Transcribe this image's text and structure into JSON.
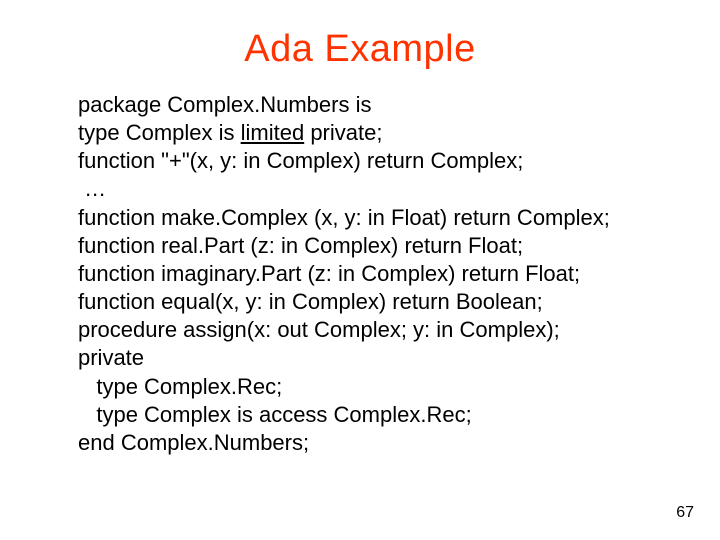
{
  "title": "Ada Example",
  "code": {
    "l1": "package Complex.Numbers is",
    "l2a": "type Complex is ",
    "l2b": "limited",
    "l2c": " private;",
    "l3": "function \"+\"(x, y: in Complex) return Complex;",
    "l4": " …",
    "l5": "function make.Complex (x, y: in Float) return Complex;",
    "l6": "function real.Part (z: in Complex) return Float;",
    "l7": "function imaginary.Part (z: in Complex) return Float;",
    "l8": "function equal(x, y: in Complex) return Boolean;",
    "l9": "procedure assign(x: out Complex; y: in Complex);",
    "l10": "private",
    "l11": "   type Complex.Rec;",
    "l12": "   type Complex is access Complex.Rec;",
    "l13": "end Complex.Numbers;"
  },
  "page_number": "67"
}
